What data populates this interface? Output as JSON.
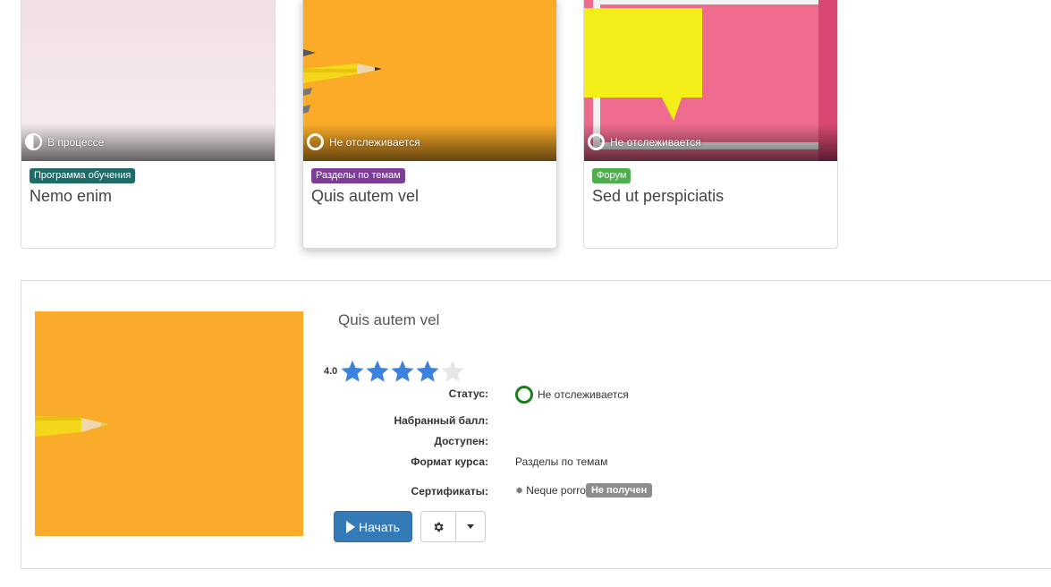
{
  "cards": [
    {
      "status": "В процессе",
      "badge": "Программа обучения",
      "badge_color": "#1e6b67",
      "title": "Nemo enim"
    },
    {
      "status": "Не отслеживается",
      "badge": "Разделы по темам",
      "badge_color": "#7d3c98",
      "title": "Quis autem vel"
    },
    {
      "status": "Не отслеживается",
      "badge": "Форум",
      "badge_color": "#4cae4c",
      "title": "Sed ut perspiciatis"
    }
  ],
  "detail": {
    "title": "Quis autem vel",
    "rating": {
      "value": "4.0",
      "stars_filled": 4,
      "stars_total": 5
    },
    "fields": {
      "status_label": "Статус:",
      "status_value": "Не отслеживается",
      "score_label": "Набранный балл:",
      "available_label": "Доступен:",
      "format_label": "Формат курса:",
      "format_value": "Разделы по темам",
      "certs_label": "Сертификаты:",
      "cert_name": "Neque porro",
      "cert_status": "Не получен"
    },
    "start_button": "Начать"
  },
  "colors": {
    "primary": "#337ab7",
    "status_green": "#1a7f1a",
    "star": "#3b82e0"
  }
}
